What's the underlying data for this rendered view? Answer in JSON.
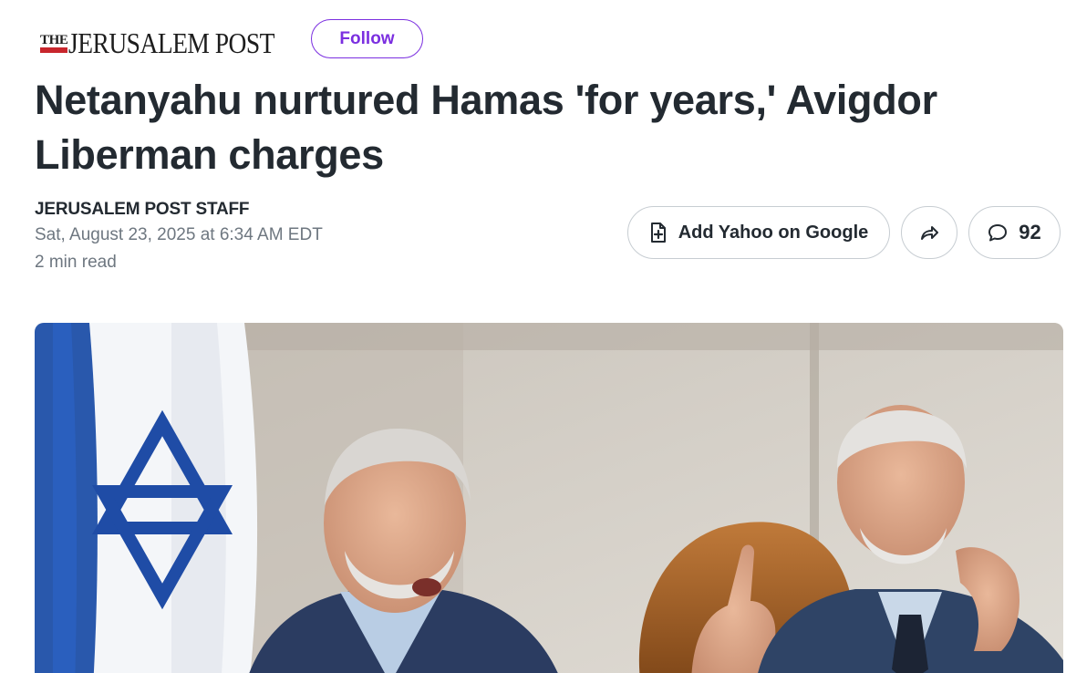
{
  "publisher": {
    "logo_the": "THE",
    "logo_main": "JERUSALEM POST",
    "follow_label": "Follow"
  },
  "article": {
    "headline": "Netanyahu nurtured Hamas 'for years,' Avigdor Liberman charges",
    "author": "JERUSALEM POST STAFF",
    "date": "Sat, August 23, 2025 at 6:34 AM EDT",
    "read_time": "2 min read"
  },
  "actions": {
    "add_google_label": "Add Yahoo on Google",
    "comment_count": "92"
  },
  "colors": {
    "accent": "#7b2fe0",
    "text": "#232a31",
    "meta": "#6e7780",
    "logo_red": "#c8262d"
  },
  "icons": {
    "add_google": "document-plus-icon",
    "share": "share-arrow-icon",
    "comments": "speech-bubble-icon"
  }
}
